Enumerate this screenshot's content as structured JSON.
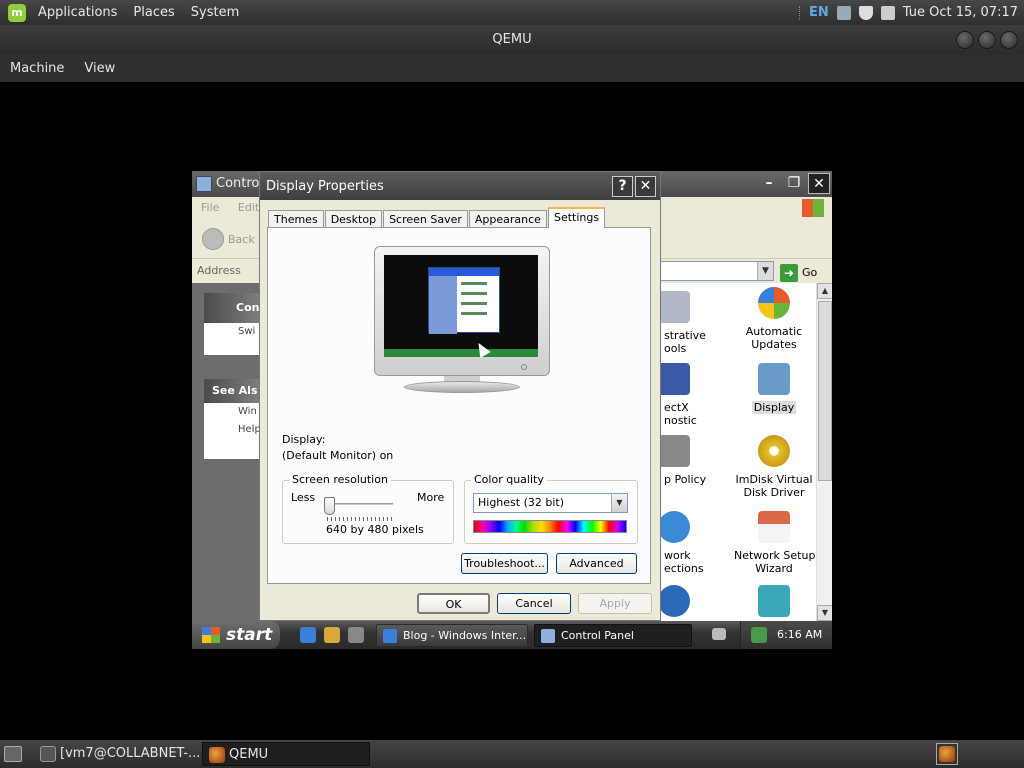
{
  "top_panel": {
    "menus": [
      "Applications",
      "Places",
      "System"
    ],
    "lang": "EN",
    "clock": "Tue Oct 15, 07:17"
  },
  "qemu": {
    "title": "QEMU",
    "menu": [
      "Machine",
      "View"
    ]
  },
  "control_panel": {
    "title": "Control",
    "menu": [
      "File",
      "Edit"
    ],
    "back_label": "Back",
    "address_label": "Address",
    "go_label": "Go",
    "left_panels": {
      "control_head": "Con",
      "switch_label": "Swi",
      "see_also_head": "See Als",
      "windows_update": "Win",
      "help": "Help"
    },
    "items": [
      {
        "label": "strative\nools",
        "icon": "admin-tools-icon"
      },
      {
        "label": "Automatic\nUpdates",
        "icon": "automatic-updates-icon"
      },
      {
        "label": "ectX\nnostic",
        "icon": "directx-icon"
      },
      {
        "label": "Display",
        "icon": "display-icon"
      },
      {
        "label": "p Policy",
        "icon": "group-policy-icon"
      },
      {
        "label": "ImDisk Virtual\nDisk Driver",
        "icon": "imdisk-icon"
      },
      {
        "label": "work\nections",
        "icon": "network-connections-icon"
      },
      {
        "label": "Network Setup\nWizard",
        "icon": "network-setup-icon"
      }
    ]
  },
  "dialog": {
    "title": "Display Properties",
    "help_btn": "?",
    "close_btn": "✕",
    "tabs": [
      "Themes",
      "Desktop",
      "Screen Saver",
      "Appearance",
      "Settings"
    ],
    "selected_tab": "Settings",
    "display_label": "Display:",
    "display_value": "(Default Monitor) on",
    "resolution": {
      "group_label": "Screen resolution",
      "less": "Less",
      "more": "More",
      "value_text": "640 by 480 pixels",
      "slider_level": 0
    },
    "color_quality": {
      "group_label": "Color quality",
      "selected": "Highest (32 bit)"
    },
    "buttons": {
      "troubleshoot": "Troubleshoot...",
      "advanced": "Advanced",
      "ok": "OK",
      "cancel": "Cancel",
      "apply": "Apply"
    }
  },
  "xp_taskbar": {
    "start": "start",
    "tasks": [
      {
        "label": "Blog - Windows Inter...",
        "active": false
      },
      {
        "label": "Control Panel",
        "active": true
      }
    ],
    "clock": "6:16 AM"
  },
  "bottom_panel": {
    "tasks": [
      {
        "label": "[vm7@COLLABNET-...",
        "active": false
      },
      {
        "label": "QEMU",
        "active": true
      }
    ]
  },
  "colors": {
    "xp_accent": "#3a9b3a",
    "tab_highlight": "#f7b64c",
    "panel_dark": "#2e2e2e"
  }
}
